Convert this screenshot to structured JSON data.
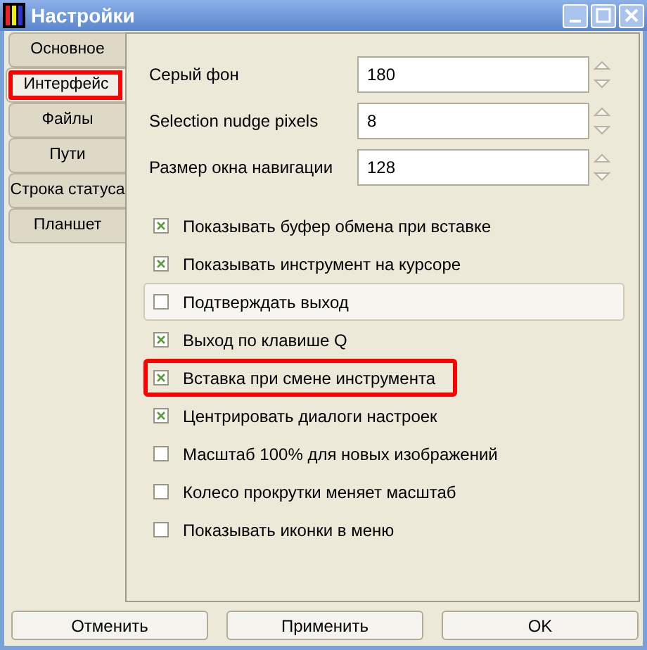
{
  "window": {
    "title": "Настройки"
  },
  "tabs": [
    {
      "label": "Основное",
      "selected": false,
      "highlighted": false
    },
    {
      "label": "Интерфейс",
      "selected": true,
      "highlighted": true
    },
    {
      "label": "Файлы",
      "selected": false,
      "highlighted": false
    },
    {
      "label": "Пути",
      "selected": false,
      "highlighted": false
    },
    {
      "label": "Строка статуса",
      "selected": false,
      "highlighted": false
    },
    {
      "label": "Планшет",
      "selected": false,
      "highlighted": false
    }
  ],
  "fields": [
    {
      "label": "Серый фон",
      "value": "180"
    },
    {
      "label": "Selection nudge pixels",
      "value": "8"
    },
    {
      "label": "Размер окна навигации",
      "value": "128"
    }
  ],
  "options": [
    {
      "label": "Показывать буфер обмена при вставке",
      "checked": true,
      "hovered": false,
      "highlighted": false
    },
    {
      "label": "Показывать инструмент на курсоре",
      "checked": true,
      "hovered": false,
      "highlighted": false
    },
    {
      "label": "Подтверждать выход",
      "checked": false,
      "hovered": true,
      "highlighted": false
    },
    {
      "label": "Выход по клавише Q",
      "checked": true,
      "hovered": false,
      "highlighted": false
    },
    {
      "label": "Вставка при смене инструмента",
      "checked": true,
      "hovered": false,
      "highlighted": true
    },
    {
      "label": "Центрировать диалоги настроек",
      "checked": true,
      "hovered": false,
      "highlighted": false
    },
    {
      "label": "Масштаб 100% для новых изображений",
      "checked": false,
      "hovered": false,
      "highlighted": false
    },
    {
      "label": "Колесо прокрутки меняет масштаб",
      "checked": false,
      "hovered": false,
      "highlighted": false
    },
    {
      "label": "Показывать иконки в меню",
      "checked": false,
      "hovered": false,
      "highlighted": false
    }
  ],
  "buttons": [
    "Отменить",
    "Применить",
    "OK"
  ]
}
